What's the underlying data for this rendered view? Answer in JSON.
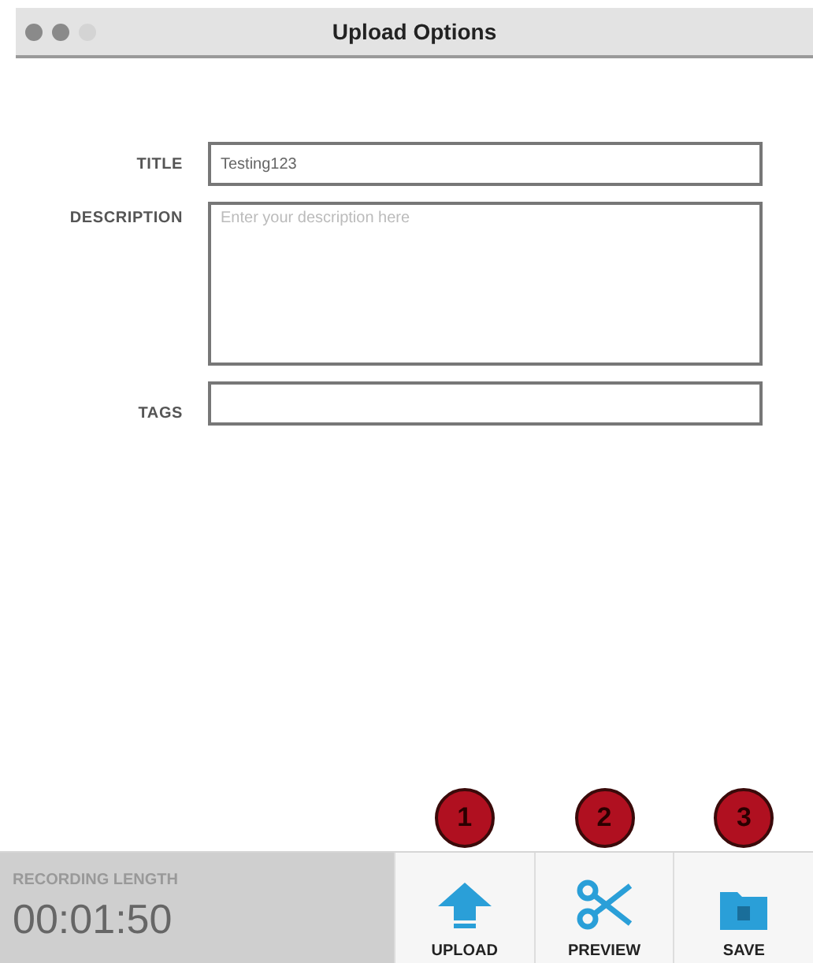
{
  "window": {
    "title": "Upload Options"
  },
  "form": [
    {
      "kind": "line",
      "label": "TITLE",
      "value": "Testing123"
    },
    {
      "kind": "area",
      "label": "DESCRIPTION",
      "placeholder": "Enter your description here"
    },
    {
      "kind": "line",
      "label": "TAGS"
    }
  ],
  "recording": {
    "label": "RECORDING LENGTH",
    "time": "00:01:50"
  },
  "actions": [
    {
      "kind": "upload",
      "label": "UPLOAD",
      "badge": "1"
    },
    {
      "kind": "preview",
      "label": "PREVIEW",
      "badge": "2"
    },
    {
      "kind": "save",
      "label": "SAVE",
      "badge": "3"
    }
  ]
}
